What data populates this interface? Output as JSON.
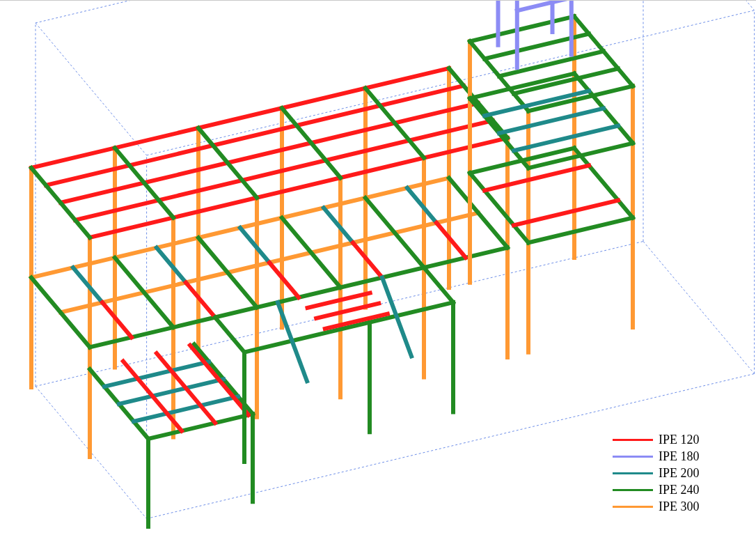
{
  "legend": [
    {
      "label": "IPE 120",
      "color": "#ff1a1a"
    },
    {
      "label": "IPE 180",
      "color": "#8c8cf5"
    },
    {
      "label": "IPE 200",
      "color": "#1f8a8a"
    },
    {
      "label": "IPE 240",
      "color": "#228b22"
    },
    {
      "label": "IPE 300",
      "color": "#ff9933"
    }
  ]
}
